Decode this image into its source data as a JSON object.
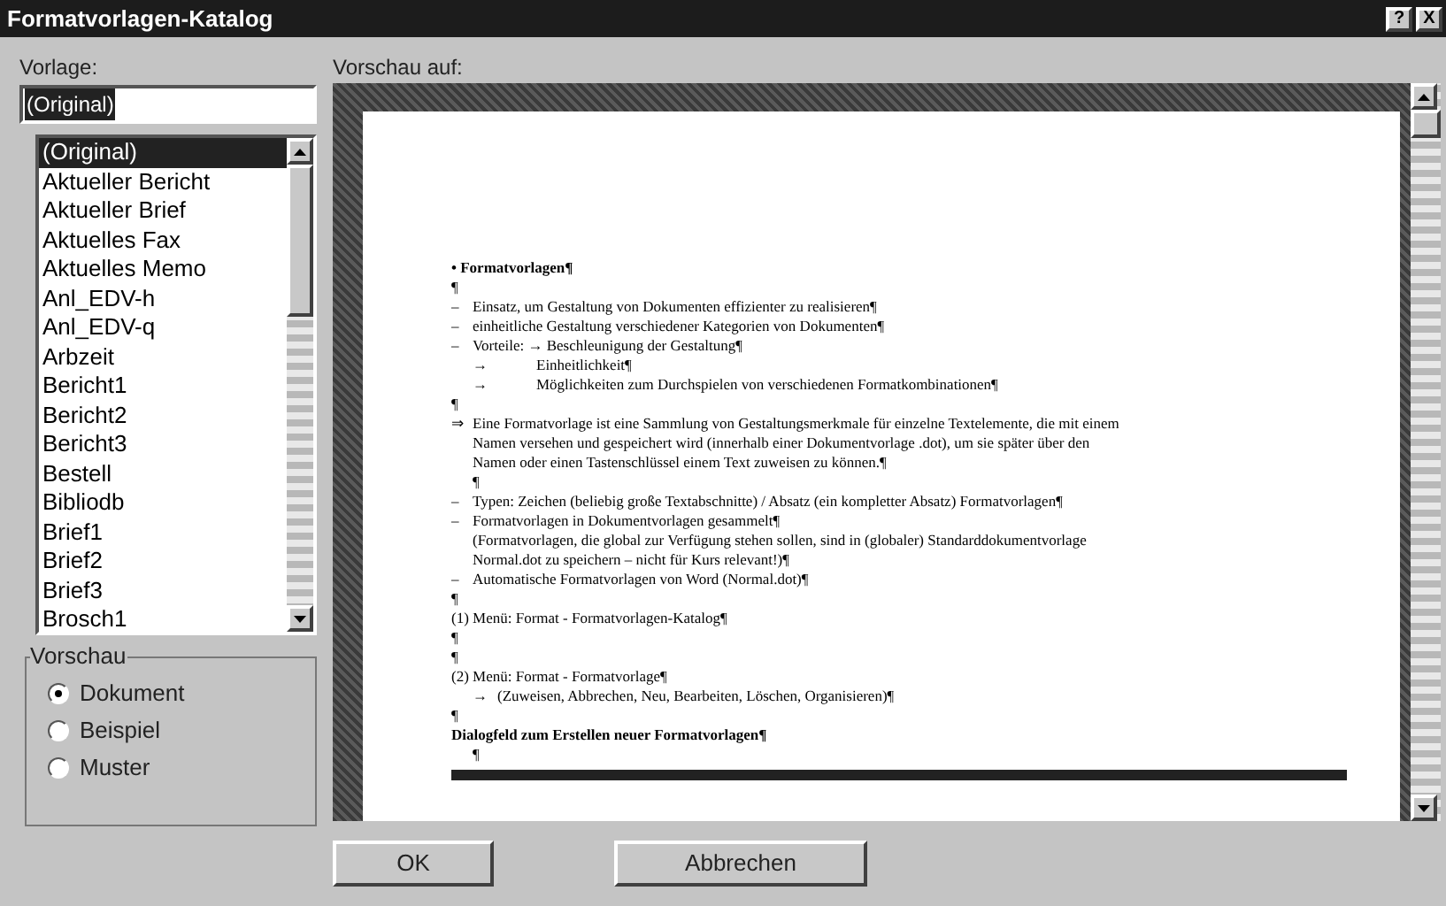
{
  "window": {
    "title": "Formatvorlagen-Katalog",
    "buttons": [
      "?",
      "X"
    ]
  },
  "template": {
    "label": "Vorlage:",
    "value": "(Original)",
    "items": [
      {
        "label": "(Original)",
        "selected": true
      },
      {
        "label": "Aktueller Bericht",
        "selected": false
      },
      {
        "label": "Aktueller Brief",
        "selected": false
      },
      {
        "label": "Aktuelles Fax",
        "selected": false
      },
      {
        "label": "Aktuelles Memo",
        "selected": false
      },
      {
        "label": "Anl_EDV-h",
        "selected": false
      },
      {
        "label": "Anl_EDV-q",
        "selected": false
      },
      {
        "label": "Arbzeit",
        "selected": false
      },
      {
        "label": "Bericht1",
        "selected": false
      },
      {
        "label": "Bericht2",
        "selected": false
      },
      {
        "label": "Bericht3",
        "selected": false
      },
      {
        "label": "Bestell",
        "selected": false
      },
      {
        "label": "Bibliodb",
        "selected": false
      },
      {
        "label": "Brief1",
        "selected": false
      },
      {
        "label": "Brief2",
        "selected": false
      },
      {
        "label": "Brief3",
        "selected": false
      },
      {
        "label": "Brosch1",
        "selected": false
      }
    ]
  },
  "preview_mode": {
    "title": "Vorschau",
    "options": [
      {
        "label": "Dokument",
        "selected": true
      },
      {
        "label": "Beispiel",
        "selected": false
      },
      {
        "label": "Muster",
        "selected": false
      }
    ]
  },
  "preview": {
    "label": "Vorschau auf:",
    "lines": [
      {
        "kind": "heading",
        "text": "• Formatvorlagen¶"
      },
      {
        "kind": "plain",
        "text": "¶"
      },
      {
        "kind": "dash",
        "marker": "–",
        "text": "Einsatz, um Gestaltung von Dokumenten effizienter zu realisieren¶"
      },
      {
        "kind": "dash",
        "marker": "–",
        "text": "einheitliche Gestaltung verschiedener Kategorien von Dokumenten¶"
      },
      {
        "kind": "dash",
        "marker": "–",
        "text": "Vorteile:  → Beschleunigung der Gestaltung¶"
      },
      {
        "kind": "sub",
        "marker": "→",
        "text": "Einheitlichkeit¶"
      },
      {
        "kind": "sub",
        "marker": "→",
        "text": "Möglichkeiten zum Durchspielen von verschiedenen Formatkombinationen¶"
      },
      {
        "kind": "plain",
        "text": "¶"
      },
      {
        "kind": "dash",
        "marker": "⇒",
        "text": "Eine Formatvorlage ist eine Sammlung von Gestaltungsmerkmale für einzelne Textelemente, die mit einem"
      },
      {
        "kind": "cont",
        "text": "Namen versehen und gespeichert wird (innerhalb einer Dokumentvorlage .dot), um sie später über den"
      },
      {
        "kind": "cont",
        "text": "Namen oder einen Tastenschlüssel einem Text zuweisen zu können.¶"
      },
      {
        "kind": "cont",
        "text": "¶"
      },
      {
        "kind": "dash",
        "marker": "–",
        "text": "Typen: Zeichen (beliebig große Textabschnitte) / Absatz (ein kompletter Absatz) Formatvorlagen¶"
      },
      {
        "kind": "dash",
        "marker": "–",
        "text": "Formatvorlagen in Dokumentvorlagen gesammelt¶"
      },
      {
        "kind": "cont",
        "text": "(Formatvorlagen, die global zur Verfügung stehen sollen, sind in (globaler) Standarddokumentvorlage"
      },
      {
        "kind": "cont",
        "text": "Normal.dot zu speichern – nicht für Kurs relevant!)¶"
      },
      {
        "kind": "dash",
        "marker": "–",
        "text": "Automatische Formatvorlagen von Word (Normal.dot)¶"
      },
      {
        "kind": "plain",
        "text": "¶"
      },
      {
        "kind": "plain",
        "text": "(1) Menü: Format - Formatvorlagen-Katalog¶"
      },
      {
        "kind": "plain",
        "text": "¶"
      },
      {
        "kind": "plain",
        "text": "¶"
      },
      {
        "kind": "plain",
        "text": "(2) Menü: Format - Formatvorlage¶"
      },
      {
        "kind": "arrow",
        "marker": "→",
        "text": "(Zuweisen, Abbrechen, Neu, Bearbeiten, Löschen, Organisieren)¶"
      },
      {
        "kind": "plain",
        "text": "¶"
      },
      {
        "kind": "heading",
        "text": "Dialogfeld zum Erstellen neuer Formatvorlagen¶"
      },
      {
        "kind": "cont",
        "text": "¶"
      }
    ]
  },
  "buttons": [
    "OK",
    "Abbrechen"
  ]
}
